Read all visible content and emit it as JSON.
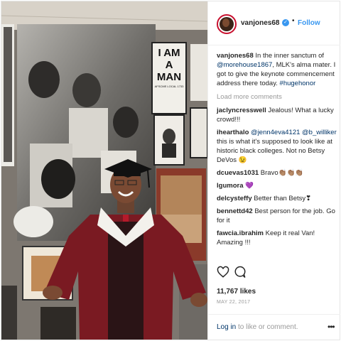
{
  "post": {
    "username": "vanjones68",
    "verified_icon": "verified-badge-icon",
    "separator": "•",
    "follow_label": "Follow",
    "poster_lines": [
      "I AM",
      "A",
      "MAN"
    ],
    "poster_small": "AFSCME LOCAL 1733",
    "caption": {
      "user": "vanjones68",
      "text1": " In the inner sanctum of ",
      "mention": "@morehouse1867",
      "text2": ", MLK's alma mater. I got to give the keynote commencement address there today. ",
      "hashtag": "#hugehonor"
    },
    "load_more": "Load more comments",
    "comments": [
      {
        "user": "jaclyncresswell",
        "text": " Jealous! What a lucky crowd!!!"
      },
      {
        "user": "ihearthalo",
        "mention1": "@jenn4eva4121",
        "mention2": "@b_williker",
        "text": " this is what it's supposed to look like at historic black colleges. Not no Betsy DeVos 😉"
      },
      {
        "user": "dcuevas1031",
        "text": " Bravo👏🏽👏🏽👏🏽"
      },
      {
        "user": "lgumora",
        "text": " 💜"
      },
      {
        "user": "delcysteffy",
        "text": " Better than Betsy❣"
      },
      {
        "user": "bennettd42",
        "text": " Best person for the job. Go for it"
      },
      {
        "user": "fawcia.ibrahim",
        "text": " Keep it real Van! Amazing !!!"
      }
    ],
    "likes": "11,767 likes",
    "date": "MAY 22, 2017",
    "login_link": "Log in",
    "login_text": " to like or comment.",
    "more_label": "•••"
  },
  "colors": {
    "link": "#3897f0",
    "mention": "#003569",
    "muted": "#999999",
    "avatar_ring": "#c8102e",
    "robe": "#7a1a22"
  }
}
